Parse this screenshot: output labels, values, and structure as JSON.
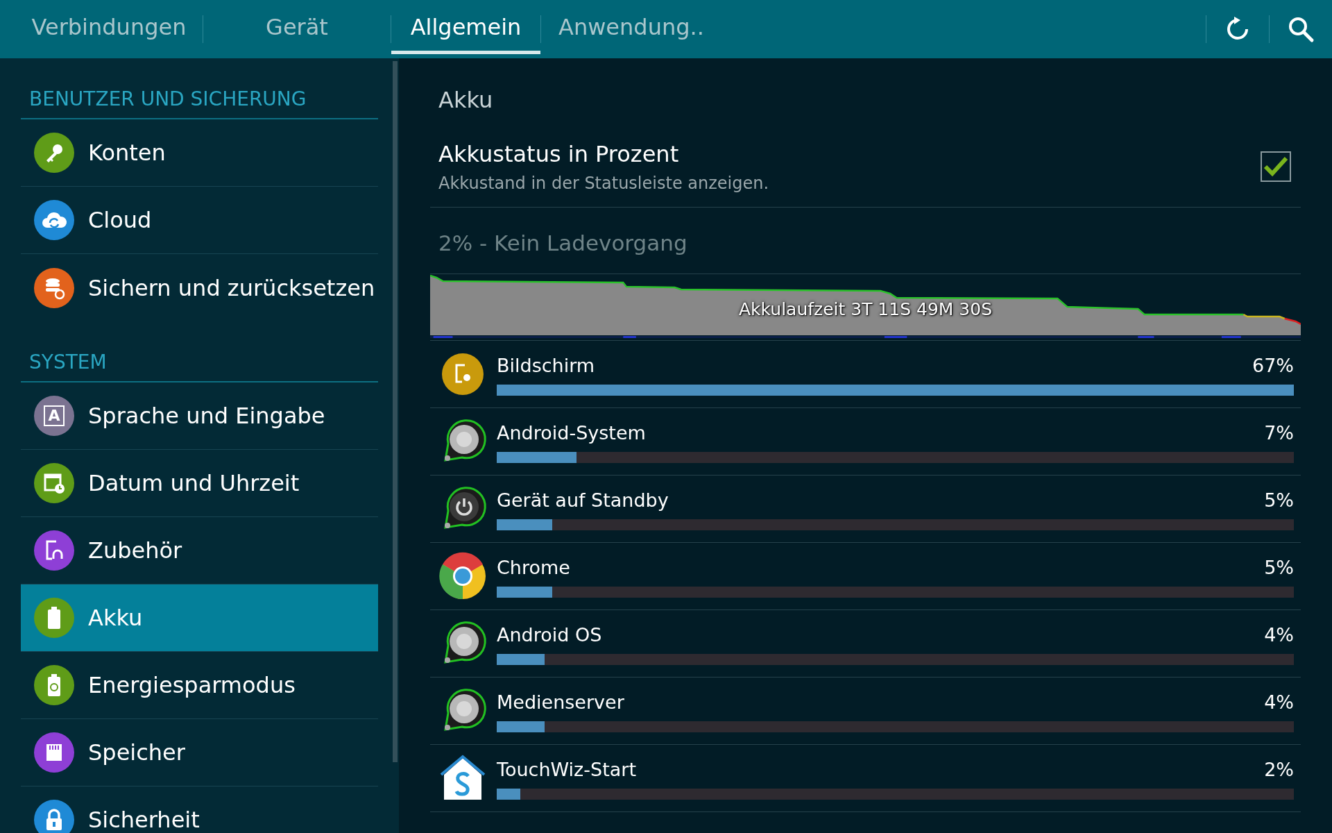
{
  "tabs": [
    {
      "label": "Verbindungen",
      "selected": false
    },
    {
      "label": "Gerät",
      "selected": false
    },
    {
      "label": "Allgemein",
      "selected": true
    },
    {
      "label": "Anwendung..",
      "selected": false
    }
  ],
  "sidebar": {
    "sections": [
      {
        "title": "BENUTZER UND SICHERUNG",
        "items": [
          {
            "label": "Konten",
            "kind": "key",
            "color": "#5f9c18",
            "selected": false
          },
          {
            "label": "Cloud",
            "kind": "cloud",
            "color": "#1f8ad6",
            "selected": false
          },
          {
            "label": "Sichern und zurücksetzen",
            "kind": "database",
            "color": "#e2621c",
            "selected": false
          }
        ]
      },
      {
        "title": "SYSTEM",
        "items": [
          {
            "label": "Sprache und Eingabe",
            "kind": "letter",
            "glyph": "A",
            "color": "#7b7391",
            "selected": false
          },
          {
            "label": "Datum und Uhrzeit",
            "kind": "calendar",
            "color": "#5f9c18",
            "selected": false
          },
          {
            "label": "Zubehör",
            "kind": "accessory",
            "color": "#8e3fd6",
            "selected": false
          },
          {
            "label": "Akku",
            "kind": "battery",
            "color": "#5f9c18",
            "selected": true
          },
          {
            "label": "Energiesparmodus",
            "kind": "recycle",
            "color": "#5f9c18",
            "selected": false
          },
          {
            "label": "Speicher",
            "kind": "card",
            "color": "#8e3fd6",
            "selected": false
          },
          {
            "label": "Sicherheit",
            "kind": "lock",
            "color": "#1f8ad6",
            "selected": false
          }
        ]
      }
    ]
  },
  "panel": {
    "title": "Akku",
    "setting": {
      "title": "Akkustatus in Prozent",
      "subtitle": "Akkustand in der Statusleiste anzeigen.",
      "checked": true
    },
    "status": "2% - Kein Ladevorgang",
    "graph": {
      "label": "Akkulaufzeit 3T 11S 49M 30S"
    },
    "usage": [
      {
        "name": "Bildschirm",
        "percent": "67%",
        "level": 1.0,
        "kind": "display"
      },
      {
        "name": "Android-System",
        "percent": "7%",
        "level": 0.1,
        "kind": "system"
      },
      {
        "name": "Gerät auf Standby",
        "percent": "5%",
        "level": 0.07,
        "kind": "power"
      },
      {
        "name": "Chrome",
        "percent": "5%",
        "level": 0.07,
        "kind": "chrome"
      },
      {
        "name": "Android OS",
        "percent": "4%",
        "level": 0.06,
        "kind": "system"
      },
      {
        "name": "Medienserver",
        "percent": "4%",
        "level": 0.06,
        "kind": "system"
      },
      {
        "name": "TouchWiz-Start",
        "percent": "2%",
        "level": 0.03,
        "kind": "home"
      }
    ]
  }
}
